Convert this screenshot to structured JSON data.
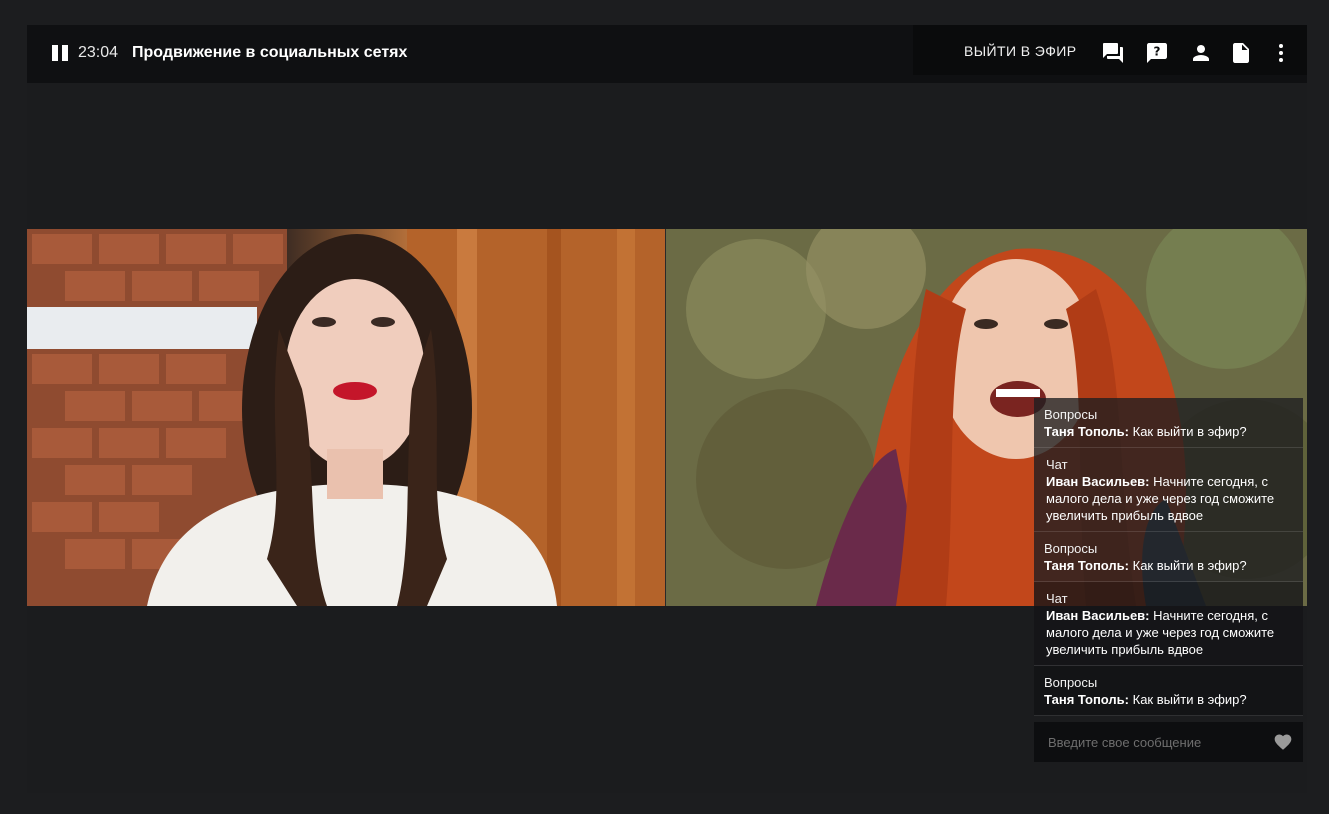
{
  "header": {
    "timer": "23:04",
    "title": "Продвижение в социальных сетях",
    "live_label": "ВЫЙТИ В ЭФИР"
  },
  "icons": {
    "pause": "pause-icon",
    "chat": "chat-icon",
    "question": "question-icon",
    "user": "person-icon",
    "document": "document-icon",
    "more": "more-vertical-icon",
    "heart": "heart-icon"
  },
  "colors": {
    "background": "#1c1d1f",
    "topbar": "#0f1012",
    "accent_text": "#ffffff"
  },
  "chat": {
    "messages": [
      {
        "kind": "Вопросы",
        "author": "Таня Тополь:",
        "text": " Как выйти в эфир?"
      },
      {
        "kind": "Чат",
        "author": "Иван Васильев:",
        "text": " Начните сегодня, с малого дела и уже через год сможите увеличить прибыль вдвое"
      },
      {
        "kind": "Вопросы",
        "author": "Таня Тополь:",
        "text": " Как выйти в эфир?"
      },
      {
        "kind": "Чат",
        "author": "Иван Васильев:",
        "text": " Начните сегодня, с малого дела и уже через год сможите увеличить прибыль вдвое"
      },
      {
        "kind": "Вопросы",
        "author": "Таня Тополь:",
        "text": " Как выйти в эфир?"
      }
    ],
    "input_placeholder": "Введите свое сообщение"
  }
}
